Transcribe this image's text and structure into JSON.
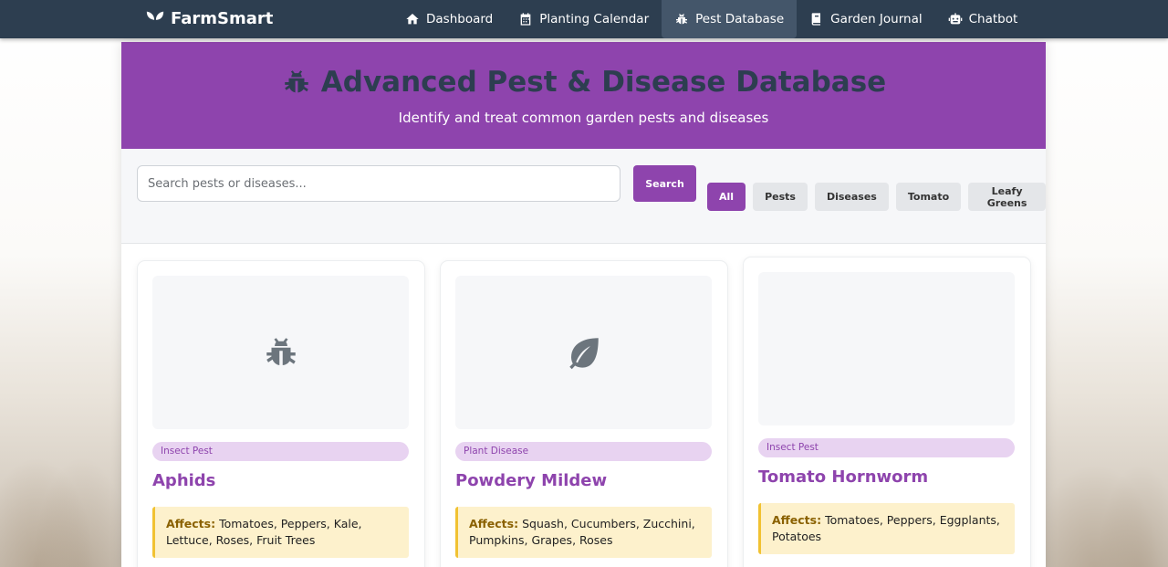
{
  "nav": {
    "brand": "FarmSmart",
    "items": [
      {
        "label": "Dashboard",
        "icon": "home-icon"
      },
      {
        "label": "Planting Calendar",
        "icon": "calendar-icon"
      },
      {
        "label": "Pest Database",
        "icon": "bug-icon",
        "active": true
      },
      {
        "label": "Garden Journal",
        "icon": "book-icon"
      },
      {
        "label": "Chatbot",
        "icon": "robot-icon"
      }
    ]
  },
  "hero": {
    "title": "Advanced Pest & Disease Database",
    "subtitle": "Identify and treat common garden pests and diseases"
  },
  "search": {
    "placeholder": "Search pests or diseases...",
    "button_label": "Search"
  },
  "filters": [
    "All",
    "Pests",
    "Diseases",
    "Tomato",
    "Leafy Greens"
  ],
  "cards": [
    {
      "tag": "Insect Pest",
      "name": "Aphids",
      "affects_label": "Affects:",
      "affects": "Tomatoes, Peppers, Kale, Lettuce, Roses, Fruit Trees",
      "icon": "bug-icon"
    },
    {
      "tag": "Plant Disease",
      "name": "Powdery Mildew",
      "affects_label": "Affects:",
      "affects": "Squash, Cucumbers, Zucchini, Pumpkins, Grapes, Roses",
      "icon": "leaf-icon"
    },
    {
      "tag": "Insect Pest",
      "name": "Tomato Hornworm",
      "affects_label": "Affects:",
      "affects": "Tomatoes, Peppers, Eggplants, Potatoes",
      "icon": ""
    }
  ],
  "colors": {
    "accent": "#8e44ad",
    "nav_bg": "#2d3e50",
    "affects_bg": "#fdf1cc"
  }
}
